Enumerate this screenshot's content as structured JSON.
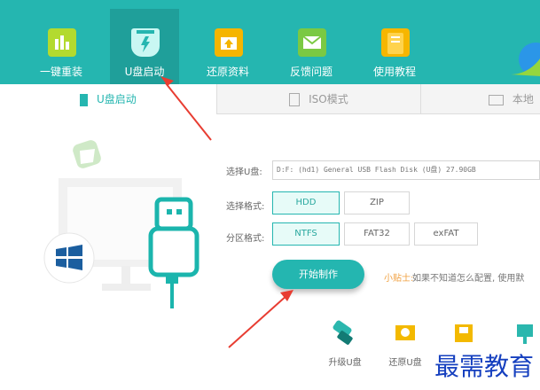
{
  "header": {
    "nav": [
      {
        "label": "一键重装",
        "icon": "bar-chart-icon"
      },
      {
        "label": "U盘启动",
        "icon": "usb-shield-icon"
      },
      {
        "label": "还原资料",
        "icon": "restore-folder-icon"
      },
      {
        "label": "反馈问题",
        "icon": "mail-icon"
      },
      {
        "label": "使用教程",
        "icon": "book-icon"
      }
    ]
  },
  "subtabs": [
    {
      "label": "U盘启动",
      "icon": "usb-drive-icon"
    },
    {
      "label": "ISO模式",
      "icon": "document-icon"
    },
    {
      "label": "本地",
      "icon": "monitor-icon"
    }
  ],
  "form": {
    "usb_label": "选择U盘:",
    "usb_value": "D:F: (hd1) General USB Flash Disk (U盘) 27.90GB",
    "format_label": "选择格式:",
    "format_options": [
      "HDD",
      "ZIP"
    ],
    "format_selected": "HDD",
    "partition_label": "分区格式:",
    "partition_options": [
      "NTFS",
      "FAT32",
      "exFAT"
    ],
    "partition_selected": "NTFS",
    "start_button": "开始制作",
    "tip_title": "小贴士:",
    "tip_text": "如果不知道怎么配置, 使用默"
  },
  "tools": [
    {
      "label": "升级U盘",
      "icon": "usb-upgrade-icon"
    },
    {
      "label": "还原U盘",
      "icon": "usb-restore-icon"
    },
    {
      "label": "",
      "icon": "usb-check-icon"
    },
    {
      "label": "",
      "icon": "usb-mark-icon"
    }
  ],
  "watermark": "最需教育",
  "colors": {
    "accent": "#25b6b0",
    "arrow": "#e83d32",
    "watermark": "#1640bf"
  }
}
